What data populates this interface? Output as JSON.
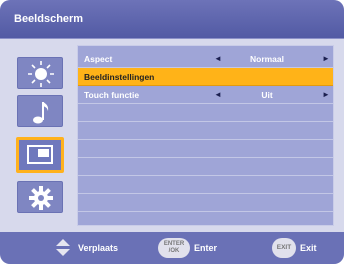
{
  "window": {
    "title": "Beeldscherm"
  },
  "sidebar": {
    "items": [
      {
        "icon": "brightness-icon",
        "active": false
      },
      {
        "icon": "music-note-icon",
        "active": false
      },
      {
        "icon": "display-icon",
        "active": true
      },
      {
        "icon": "gear-icon",
        "active": false
      }
    ]
  },
  "menu": {
    "rows": [
      {
        "label": "Aspect",
        "value": "Normaal",
        "selected": false
      },
      {
        "label": "Beeldinstellingen",
        "value": "",
        "selected": true
      },
      {
        "label": "Touch functie",
        "value": "Uit",
        "selected": false
      }
    ],
    "arrows": {
      "left": "◄",
      "right": "►"
    }
  },
  "footer": {
    "move_label": "Verplaats",
    "enter_key_top": "ENTER",
    "enter_key_bottom": "/OK",
    "enter_label": "Enter",
    "exit_key": "EXIT",
    "exit_label": "Exit"
  },
  "colors": {
    "title_bar": "#5d64ad",
    "panel": "#9fa5d7",
    "selection": "#ffb318",
    "active_outline": "#ffb11c"
  }
}
